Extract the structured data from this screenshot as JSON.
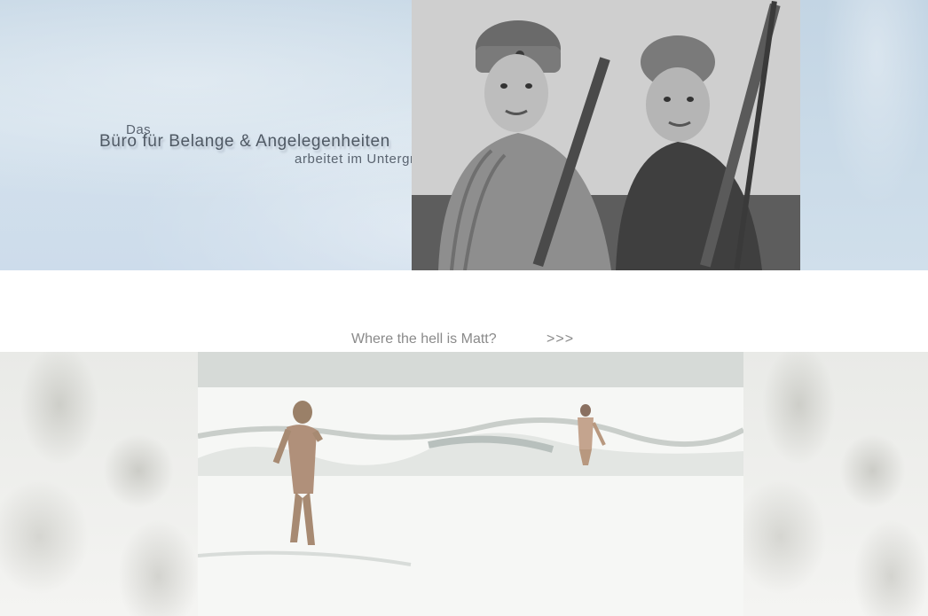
{
  "banner": {
    "title_das": "Das",
    "title_main": "Büro für Belange & Angelegenheiten",
    "title_sub": "arbeitet im Untergrund ..."
  },
  "nav": {
    "matt_link": "Where the hell is Matt?",
    "next_link": ">>>"
  },
  "colors": {
    "banner_water": "#cddceb",
    "link_text": "#8a8a8a",
    "title_text": "#4f5964"
  }
}
